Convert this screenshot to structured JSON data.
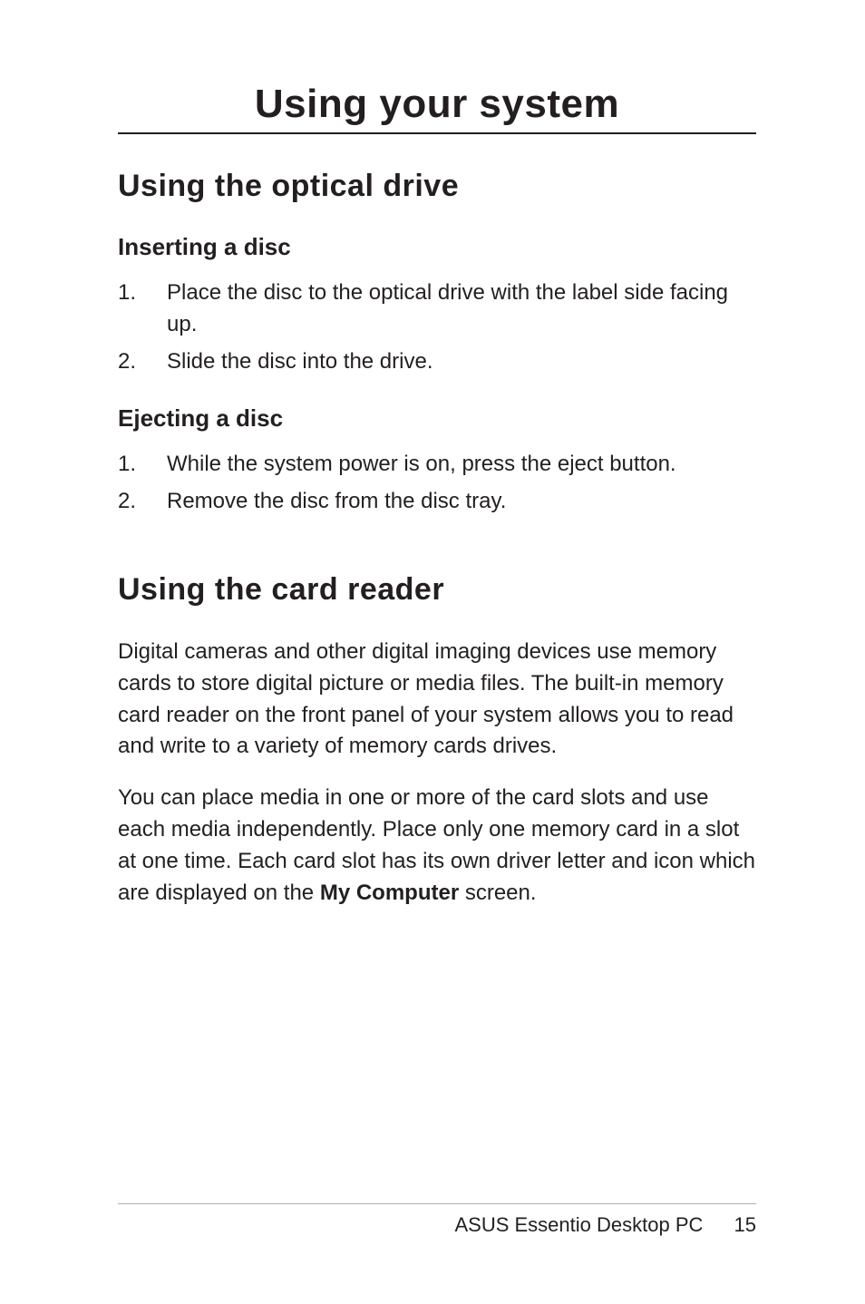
{
  "chapter": {
    "title": "Using your system"
  },
  "section1": {
    "title": "Using the optical drive",
    "sub1": {
      "heading": "Inserting a disc",
      "steps": [
        "Place the disc to the optical drive with the label side facing up.",
        "Slide the disc into the drive."
      ]
    },
    "sub2": {
      "heading": "Ejecting a disc",
      "steps": [
        "While the system power is on, press the eject button.",
        "Remove the disc from the disc tray."
      ]
    }
  },
  "section2": {
    "title": "Using the card reader",
    "para1": "Digital cameras and other digital imaging devices use memory cards to store digital picture or media files. The built-in memory card reader on the front panel of your system allows you to read and write to a variety of memory cards drives.",
    "para2_pre": "You can place media in one or more of the card slots and use each media independently. Place only one memory card in a slot at one time. Each card slot has its own driver letter and icon which are displayed on the ",
    "para2_bold": "My Computer",
    "para2_post": " screen."
  },
  "footer": {
    "product": "ASUS Essentio Desktop PC",
    "page": "15"
  }
}
